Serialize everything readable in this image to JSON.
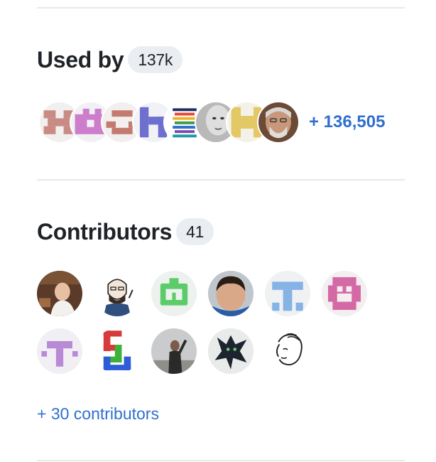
{
  "used_by": {
    "title": "Used by",
    "count": "137k",
    "more_label": "+ 136,505"
  },
  "contributors": {
    "title": "Contributors",
    "count": "41",
    "more_label": "+ 30 contributors"
  },
  "colors": {
    "link": "#2f6fcf",
    "divider": "#e6e8eb",
    "counter_bg": "#eaeef2"
  }
}
